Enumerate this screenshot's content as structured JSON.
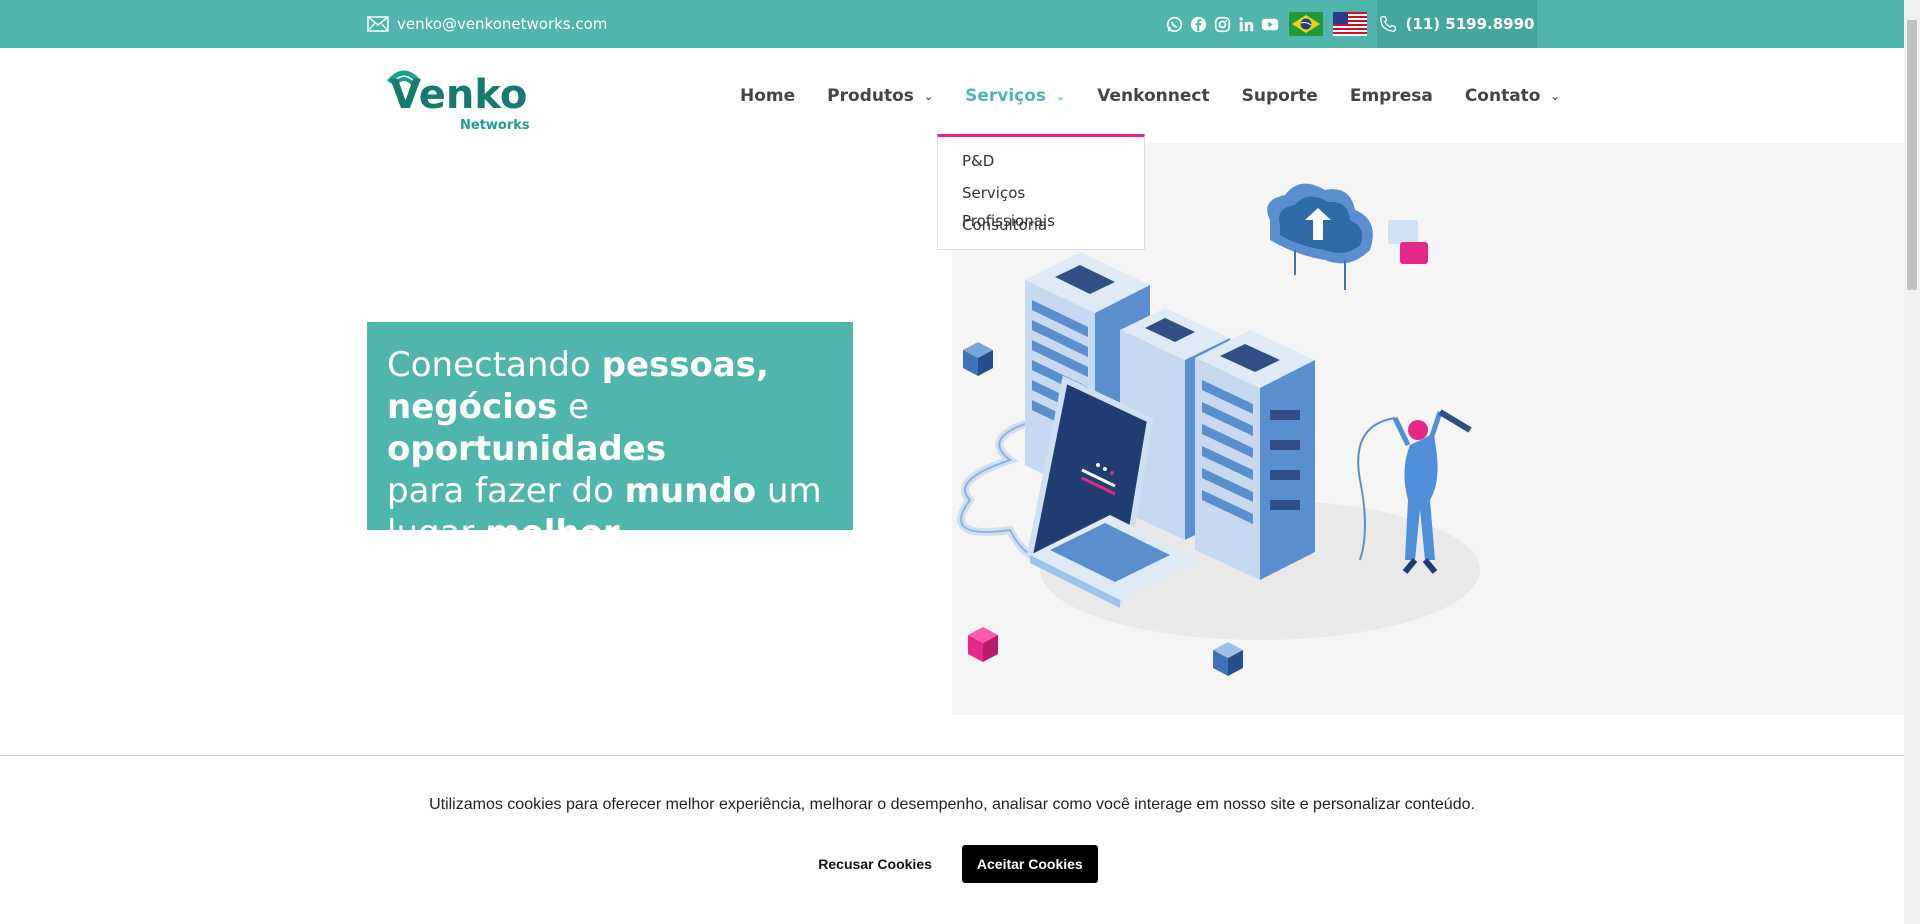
{
  "topbar": {
    "email": "venko@venkonetworks.com",
    "phone": "(11) 5199.8990",
    "socials": [
      "whatsapp-icon",
      "facebook-icon",
      "instagram-icon",
      "linkedin-icon",
      "youtube-icon"
    ],
    "languages": [
      "brazil-flag",
      "usa-flag"
    ],
    "color": "#4fb5ad"
  },
  "logo": {
    "title": "Venko",
    "subtitle": "Networks"
  },
  "nav": {
    "items": [
      {
        "label": "Home",
        "has_dropdown": false
      },
      {
        "label": "Produtos",
        "has_dropdown": true
      },
      {
        "label": "Serviços",
        "has_dropdown": true,
        "active": true
      },
      {
        "label": "Venkonnect",
        "has_dropdown": false
      },
      {
        "label": "Suporte",
        "has_dropdown": false
      },
      {
        "label": "Empresa",
        "has_dropdown": false
      },
      {
        "label": "Contato",
        "has_dropdown": true
      }
    ],
    "active_color": "#4fb5ad"
  },
  "dropdown": {
    "items": [
      "P&D",
      "Serviços Profissionais",
      "Consultoria"
    ],
    "accent": "#e5278a"
  },
  "hero": {
    "l1a": "Conectando ",
    "l1b": "pessoas,",
    "l2a": "negócios",
    "l2b": " e ",
    "l2c": "oportunidades",
    "l3a": "para fazer do ",
    "l3b": "mundo",
    "l3c": " um",
    "l4a": "lugar ",
    "l4b": "melhor"
  },
  "cookie": {
    "message": "Utilizamos cookies para oferecer melhor experiência, melhorar o desempenho, analisar como você interage em nosso site e personalizar conteúdo.",
    "refuse": "Recusar Cookies",
    "accept": "Aceitar Cookies"
  }
}
